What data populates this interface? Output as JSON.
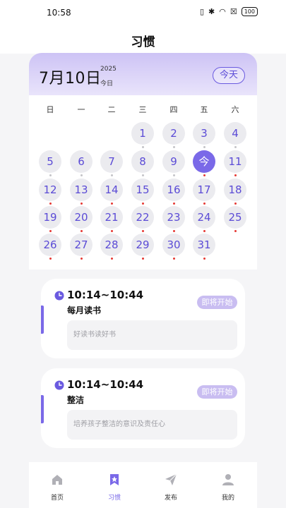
{
  "status_bar": {
    "time": "10:58",
    "battery": "100"
  },
  "page_title": "习惯",
  "calendar": {
    "big_date": "7月10日",
    "year": "2025",
    "today_label": "今日",
    "today_button": "今天",
    "weekdays": [
      "日",
      "一",
      "二",
      "三",
      "四",
      "五",
      "六"
    ],
    "days": [
      {
        "label": "1",
        "dot": "gray"
      },
      {
        "label": "2",
        "dot": "gray"
      },
      {
        "label": "3",
        "dot": "gray"
      },
      {
        "label": "4",
        "dot": "gray"
      },
      {
        "label": "5",
        "dot": "gray"
      },
      {
        "label": "6",
        "dot": "gray"
      },
      {
        "label": "7",
        "dot": "gray"
      },
      {
        "label": "8",
        "dot": "gray"
      },
      {
        "label": "9",
        "dot": "gray"
      },
      {
        "label": "今",
        "dot": "red",
        "today": true
      },
      {
        "label": "11",
        "dot": "red"
      },
      {
        "label": "12",
        "dot": "red"
      },
      {
        "label": "13",
        "dot": "red"
      },
      {
        "label": "14",
        "dot": "red"
      },
      {
        "label": "15",
        "dot": "red"
      },
      {
        "label": "16",
        "dot": "red"
      },
      {
        "label": "17",
        "dot": "red"
      },
      {
        "label": "18",
        "dot": "red"
      },
      {
        "label": "19",
        "dot": "red"
      },
      {
        "label": "20",
        "dot": "red"
      },
      {
        "label": "21",
        "dot": "red"
      },
      {
        "label": "22",
        "dot": "red"
      },
      {
        "label": "23",
        "dot": "red"
      },
      {
        "label": "24",
        "dot": "red"
      },
      {
        "label": "25",
        "dot": "red"
      },
      {
        "label": "26",
        "dot": "red"
      },
      {
        "label": "27",
        "dot": "red"
      },
      {
        "label": "28",
        "dot": "red"
      },
      {
        "label": "29",
        "dot": "red"
      },
      {
        "label": "30",
        "dot": "red"
      },
      {
        "label": "31",
        "dot": "red"
      }
    ]
  },
  "habits": [
    {
      "time": "10:14~10:44",
      "name": "每月读书",
      "status": "即将开始",
      "description": "好读书读好书"
    },
    {
      "time": "10:14~10:44",
      "name": "整洁",
      "status": "即将开始",
      "description": "培养孩子整洁的意识及责任心"
    }
  ],
  "tabs": [
    {
      "label": "首页",
      "icon": "home-icon"
    },
    {
      "label": "习惯",
      "icon": "bookmark-star-icon",
      "active": true
    },
    {
      "label": "发布",
      "icon": "paper-plane-icon"
    },
    {
      "label": "我的",
      "icon": "person-icon"
    }
  ],
  "colors": {
    "accent": "#7a69e8",
    "dot_red": "#e53935",
    "badge": "#c9bdf1"
  }
}
